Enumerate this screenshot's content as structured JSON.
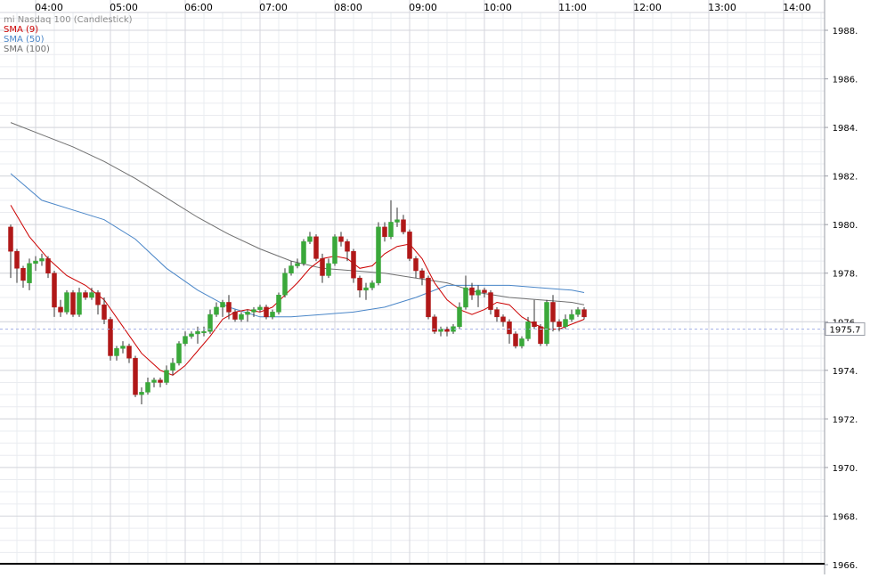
{
  "chart_data": {
    "type": "candlestick",
    "title": "mi Nasdaq 100 (Candlestick)",
    "legend": [
      {
        "label": "SMA (9)",
        "color": "#cc0000"
      },
      {
        "label": "SMA (50)",
        "color": "#4a86c8"
      },
      {
        "label": "SMA (100)",
        "color": "#707070"
      }
    ],
    "x_ticks": [
      "04:00",
      "05:00",
      "06:00",
      "07:00",
      "08:00",
      "09:00",
      "10:00",
      "11:00",
      "12:00",
      "13:00",
      "14:00"
    ],
    "y_ticks": [
      "1988.",
      "1986.",
      "1984.",
      "1982.",
      "1980.",
      "1978.",
      "1976.",
      "1974.",
      "1972.",
      "1970.",
      "1968.",
      "1966."
    ],
    "ylim": [
      1966,
      1988.8
    ],
    "last_price": "1975.7",
    "last_price_value": 1975.7,
    "candles_start_time": "03:40",
    "candle_interval_min": 5,
    "candles": [
      [
        1979.9,
        1978.9,
        1980.0,
        1977.8
      ],
      [
        1978.9,
        1978.2,
        1979.0,
        1977.6
      ],
      [
        1978.2,
        1977.7,
        1978.3,
        1977.4
      ],
      [
        1977.6,
        1978.4,
        1978.6,
        1977.3
      ],
      [
        1978.4,
        1978.5,
        1978.7,
        1978.1
      ],
      [
        1978.5,
        1978.6,
        1978.8,
        1978.3
      ],
      [
        1978.6,
        1978.0,
        1978.7,
        1977.8
      ],
      [
        1978.0,
        1976.6,
        1978.1,
        1976.2
      ],
      [
        1976.6,
        1976.4,
        1976.9,
        1976.2
      ],
      [
        1976.4,
        1977.2,
        1977.3,
        1976.3
      ],
      [
        1977.2,
        1976.3,
        1977.3,
        1976.2
      ],
      [
        1976.3,
        1977.2,
        1977.4,
        1976.2
      ],
      [
        1977.2,
        1977.0,
        1977.3,
        1976.9
      ],
      [
        1977.0,
        1977.2,
        1977.4,
        1976.9
      ],
      [
        1977.2,
        1976.7,
        1977.3,
        1976.3
      ],
      [
        1976.7,
        1976.1,
        1977.0,
        1975.9
      ],
      [
        1976.1,
        1974.6,
        1976.2,
        1974.4
      ],
      [
        1974.6,
        1974.9,
        1975.0,
        1974.4
      ],
      [
        1974.9,
        1975.0,
        1975.2,
        1974.7
      ],
      [
        1975.0,
        1974.5,
        1975.1,
        1974.3
      ],
      [
        1974.5,
        1973.0,
        1974.6,
        1972.9
      ],
      [
        1973.0,
        1973.1,
        1973.3,
        1972.6
      ],
      [
        1973.1,
        1973.5,
        1973.7,
        1973.0
      ],
      [
        1973.5,
        1973.6,
        1973.7,
        1973.3
      ],
      [
        1973.6,
        1973.5,
        1973.7,
        1973.3
      ],
      [
        1973.5,
        1974.0,
        1974.2,
        1973.4
      ],
      [
        1974.0,
        1974.3,
        1974.5,
        1973.8
      ],
      [
        1974.3,
        1975.1,
        1975.2,
        1974.2
      ],
      [
        1975.1,
        1975.4,
        1975.6,
        1975.0
      ],
      [
        1975.4,
        1975.5,
        1975.6,
        1975.3
      ],
      [
        1975.5,
        1975.6,
        1975.8,
        1975.1
      ],
      [
        1975.6,
        1975.6,
        1975.8,
        1975.4
      ],
      [
        1975.6,
        1976.3,
        1976.5,
        1975.5
      ],
      [
        1976.3,
        1976.6,
        1976.8,
        1976.2
      ],
      [
        1976.6,
        1976.8,
        1976.9,
        1976.2
      ],
      [
        1976.8,
        1976.4,
        1977.1,
        1976.1
      ],
      [
        1976.4,
        1976.1,
        1976.5,
        1976.0
      ],
      [
        1976.1,
        1976.3,
        1976.4,
        1976.0
      ],
      [
        1976.3,
        1976.4,
        1976.5,
        1976.0
      ],
      [
        1976.4,
        1976.5,
        1976.6,
        1976.2
      ],
      [
        1976.5,
        1976.6,
        1976.7,
        1976.4
      ],
      [
        1976.6,
        1976.2,
        1976.7,
        1976.1
      ],
      [
        1976.2,
        1976.4,
        1976.5,
        1976.1
      ],
      [
        1976.4,
        1977.1,
        1977.2,
        1976.3
      ],
      [
        1977.1,
        1978.0,
        1978.2,
        1977.0
      ],
      [
        1978.0,
        1978.3,
        1978.5,
        1977.9
      ],
      [
        1978.3,
        1978.4,
        1978.6,
        1978.2
      ],
      [
        1978.4,
        1979.3,
        1979.4,
        1978.3
      ],
      [
        1979.3,
        1979.5,
        1979.7,
        1979.2
      ],
      [
        1979.5,
        1978.6,
        1979.6,
        1978.5
      ],
      [
        1978.6,
        1977.9,
        1978.8,
        1977.6
      ],
      [
        1977.9,
        1978.4,
        1978.6,
        1977.8
      ],
      [
        1978.4,
        1979.5,
        1979.6,
        1978.3
      ],
      [
        1979.5,
        1979.3,
        1979.7,
        1979.1
      ],
      [
        1979.3,
        1978.9,
        1979.4,
        1978.5
      ],
      [
        1978.9,
        1977.8,
        1979.0,
        1977.6
      ],
      [
        1977.8,
        1977.3,
        1977.9,
        1977.0
      ],
      [
        1977.3,
        1977.4,
        1977.6,
        1976.9
      ],
      [
        1977.4,
        1977.6,
        1977.7,
        1977.3
      ],
      [
        1977.6,
        1979.9,
        1980.1,
        1977.5
      ],
      [
        1979.9,
        1979.5,
        1980.1,
        1979.3
      ],
      [
        1979.5,
        1980.1,
        1981.0,
        1979.4
      ],
      [
        1980.1,
        1980.2,
        1980.7,
        1979.9
      ],
      [
        1980.2,
        1979.7,
        1980.4,
        1979.6
      ],
      [
        1979.7,
        1978.6,
        1979.8,
        1978.5
      ],
      [
        1978.6,
        1978.1,
        1978.7,
        1977.8
      ],
      [
        1978.1,
        1977.8,
        1978.2,
        1977.5
      ],
      [
        1977.8,
        1976.2,
        1977.9,
        1976.1
      ],
      [
        1976.2,
        1975.6,
        1976.3,
        1975.5
      ],
      [
        1975.6,
        1975.7,
        1975.8,
        1975.4
      ],
      [
        1975.7,
        1975.6,
        1975.8,
        1975.4
      ],
      [
        1975.6,
        1975.8,
        1975.9,
        1975.5
      ],
      [
        1975.8,
        1976.6,
        1976.8,
        1975.7
      ],
      [
        1976.6,
        1977.4,
        1977.9,
        1976.5
      ],
      [
        1977.4,
        1977.1,
        1977.6,
        1976.9
      ],
      [
        1977.1,
        1977.3,
        1977.5,
        1976.6
      ],
      [
        1977.3,
        1977.2,
        1977.4,
        1977.0
      ],
      [
        1977.2,
        1976.5,
        1977.3,
        1976.3
      ],
      [
        1976.5,
        1976.2,
        1976.6,
        1976.0
      ],
      [
        1976.2,
        1976.0,
        1976.3,
        1975.8
      ],
      [
        1976.0,
        1975.5,
        1976.1,
        1975.1
      ],
      [
        1975.5,
        1975.0,
        1975.6,
        1974.9
      ],
      [
        1975.0,
        1975.3,
        1975.4,
        1974.9
      ],
      [
        1975.3,
        1976.0,
        1976.2,
        1975.2
      ],
      [
        1976.0,
        1975.8,
        1976.9,
        1975.7
      ],
      [
        1975.8,
        1975.1,
        1975.9,
        1975.0
      ],
      [
        1975.1,
        1976.8,
        1976.9,
        1975.0
      ],
      [
        1976.8,
        1976.0,
        1977.1,
        1975.6
      ],
      [
        1976.0,
        1975.8,
        1976.1,
        1975.6
      ],
      [
        1975.8,
        1976.1,
        1976.3,
        1975.7
      ],
      [
        1976.1,
        1976.3,
        1976.5,
        1976.0
      ],
      [
        1976.3,
        1976.5,
        1976.6,
        1976.2
      ],
      [
        1976.5,
        1976.2,
        1976.6,
        1976.1
      ]
    ],
    "sma9": [
      [
        0,
        1980.8
      ],
      [
        3,
        1979.5
      ],
      [
        6,
        1978.6
      ],
      [
        9,
        1977.9
      ],
      [
        12,
        1977.5
      ],
      [
        15,
        1976.9
      ],
      [
        18,
        1975.8
      ],
      [
        21,
        1974.7
      ],
      [
        24,
        1974.0
      ],
      [
        26,
        1973.8
      ],
      [
        28,
        1974.2
      ],
      [
        30,
        1974.8
      ],
      [
        32,
        1975.4
      ],
      [
        34,
        1976.1
      ],
      [
        36,
        1976.4
      ],
      [
        38,
        1976.5
      ],
      [
        40,
        1976.4
      ],
      [
        42,
        1976.6
      ],
      [
        44,
        1977.1
      ],
      [
        46,
        1977.6
      ],
      [
        48,
        1978.2
      ],
      [
        50,
        1978.6
      ],
      [
        52,
        1978.7
      ],
      [
        54,
        1978.6
      ],
      [
        56,
        1978.2
      ],
      [
        58,
        1978.3
      ],
      [
        60,
        1978.8
      ],
      [
        62,
        1979.1
      ],
      [
        64,
        1979.2
      ],
      [
        66,
        1978.6
      ],
      [
        68,
        1977.6
      ],
      [
        70,
        1976.9
      ],
      [
        72,
        1976.5
      ],
      [
        74,
        1976.3
      ],
      [
        76,
        1976.5
      ],
      [
        78,
        1976.8
      ],
      [
        80,
        1976.7
      ],
      [
        82,
        1976.2
      ],
      [
        84,
        1975.9
      ],
      [
        86,
        1975.7
      ],
      [
        88,
        1975.7
      ],
      [
        90,
        1975.9
      ],
      [
        92,
        1976.1
      ]
    ],
    "sma50": [
      [
        0,
        1982.1
      ],
      [
        5,
        1981.0
      ],
      [
        10,
        1980.6
      ],
      [
        15,
        1980.2
      ],
      [
        20,
        1979.4
      ],
      [
        25,
        1978.2
      ],
      [
        30,
        1977.3
      ],
      [
        35,
        1976.6
      ],
      [
        40,
        1976.2
      ],
      [
        45,
        1976.2
      ],
      [
        50,
        1976.3
      ],
      [
        55,
        1976.4
      ],
      [
        60,
        1976.6
      ],
      [
        65,
        1977.0
      ],
      [
        70,
        1977.5
      ],
      [
        75,
        1977.5
      ],
      [
        80,
        1977.5
      ],
      [
        85,
        1977.4
      ],
      [
        90,
        1977.3
      ],
      [
        92,
        1977.2
      ]
    ],
    "sma100": [
      [
        0,
        1984.2
      ],
      [
        5,
        1983.7
      ],
      [
        10,
        1983.2
      ],
      [
        15,
        1982.6
      ],
      [
        20,
        1981.9
      ],
      [
        25,
        1981.1
      ],
      [
        30,
        1980.3
      ],
      [
        35,
        1979.6
      ],
      [
        40,
        1979.0
      ],
      [
        45,
        1978.5
      ],
      [
        50,
        1978.2
      ],
      [
        55,
        1978.1
      ],
      [
        60,
        1978.0
      ],
      [
        65,
        1977.8
      ],
      [
        70,
        1977.6
      ],
      [
        75,
        1977.2
      ],
      [
        80,
        1977.0
      ],
      [
        85,
        1976.9
      ],
      [
        90,
        1976.8
      ],
      [
        92,
        1976.7
      ]
    ],
    "colors": {
      "up": "#3aa83a",
      "down": "#b01818",
      "sma9": "#cc0000",
      "sma50": "#4a86c8",
      "sma100": "#707070",
      "grid": "#d4d6dc",
      "grid_minor": "#eaecf0"
    }
  }
}
